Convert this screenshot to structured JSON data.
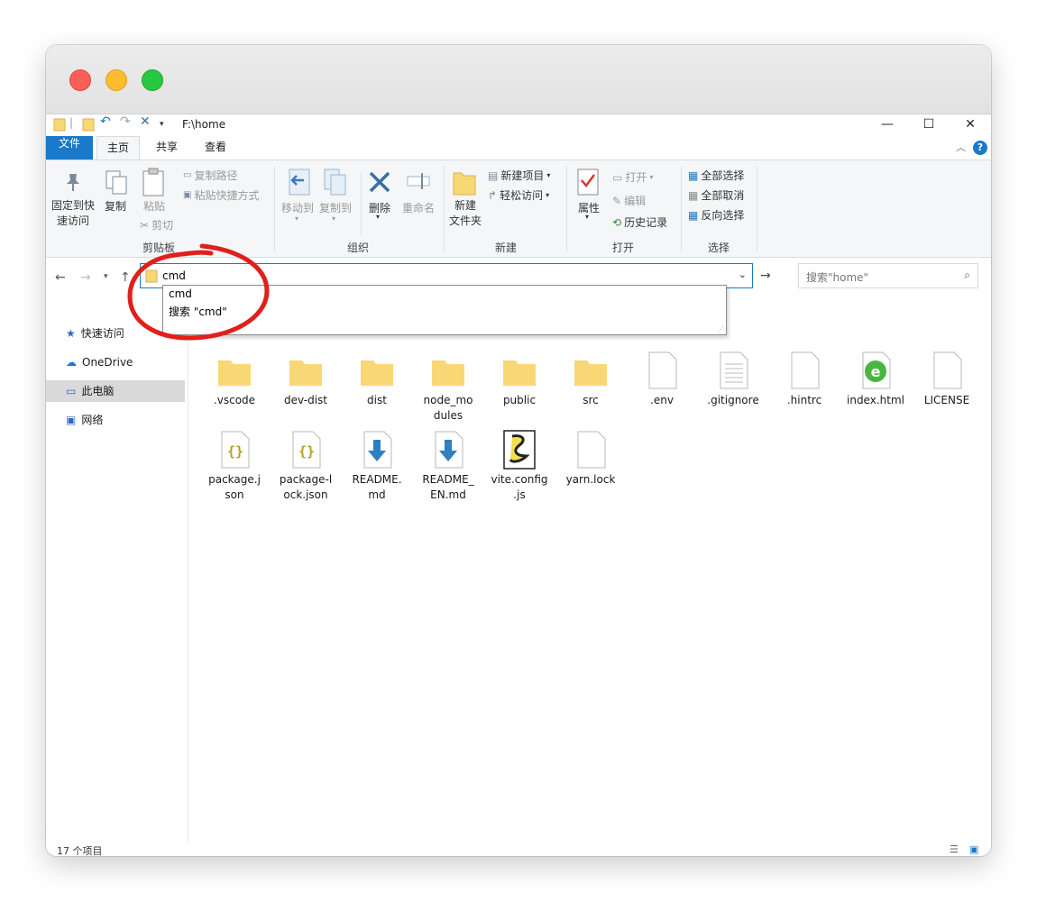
{
  "window": {
    "title_path": "F:\\home",
    "controls": {
      "minimize": "—",
      "maximize": "☐",
      "close": "✕"
    }
  },
  "ribbon_tabs": {
    "file": "文件",
    "home": "主页",
    "share": "共享",
    "view": "查看"
  },
  "ribbon": {
    "clipboard": {
      "label": "剪贴板",
      "pin": "固定到快速访问",
      "pin_line1": "固定到快",
      "pin_line2": "速访问",
      "copy": "复制",
      "paste": "粘贴",
      "copy_path": "复制路径",
      "paste_shortcut": "粘贴快捷方式",
      "cut": "剪切"
    },
    "organize": {
      "label": "组织",
      "move_to": "移动到",
      "copy_to": "复制到",
      "delete": "删除",
      "rename": "重命名"
    },
    "new": {
      "label": "新建",
      "new_folder_line1": "新建",
      "new_folder_line2": "文件夹",
      "new_item": "新建项目",
      "easy_access": "轻松访问"
    },
    "open": {
      "label": "打开",
      "properties": "属性",
      "open": "打开",
      "edit": "编辑",
      "history": "历史记录"
    },
    "select": {
      "label": "选择",
      "select_all": "全部选择",
      "select_none": "全部取消",
      "invert": "反向选择"
    }
  },
  "address": {
    "value": "cmd",
    "search_placeholder": "搜索\"home\""
  },
  "suggestions": [
    "cmd",
    "搜索 \"cmd\""
  ],
  "sidebar": [
    {
      "label": "快速访问",
      "icon": "star-icon"
    },
    {
      "label": "OneDrive",
      "icon": "cloud-icon"
    },
    {
      "label": "此电脑",
      "icon": "computer-icon",
      "selected": true
    },
    {
      "label": "网络",
      "icon": "network-icon"
    }
  ],
  "files_row1": [
    ".vscode",
    "dev-dist",
    "dist",
    "node_modules",
    "public",
    "src",
    ".env",
    ".gitignore",
    ".hintrc",
    "index.html",
    "LICENSE"
  ],
  "files_row1_display": [
    ".vscode",
    "dev-dist",
    "dist",
    "node_mo\ndules",
    "public",
    "src",
    ".env",
    ".gitignore",
    ".hintrc",
    "index.html",
    "LICENSE"
  ],
  "files_row2": [
    {
      "line1": "package.j",
      "line2": "son"
    },
    {
      "line1": "package-l",
      "line2": "ock.json"
    },
    {
      "line1": "README.",
      "line2": "md"
    },
    {
      "line1": "README_",
      "line2": "EN.md"
    },
    {
      "line1": "vite.config",
      "line2": ".js"
    },
    {
      "line1": "yarn.lock",
      "line2": ""
    }
  ],
  "status": {
    "count": "17 个项目"
  },
  "colors": {
    "accent": "#1979ca",
    "annotation": "#e0201b",
    "folder": "#f8d775"
  }
}
